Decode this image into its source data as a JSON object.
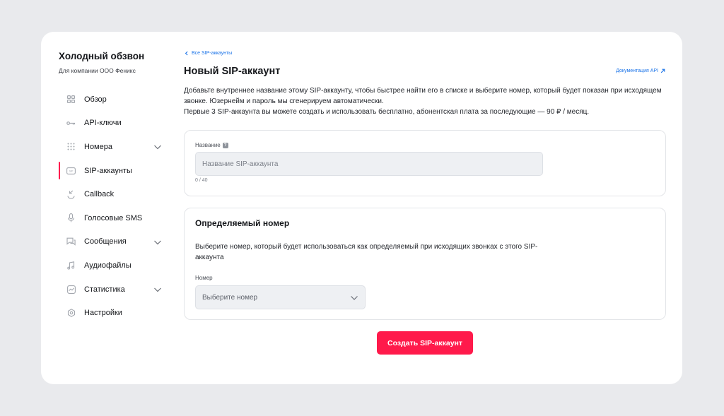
{
  "app": {
    "title": "Холодный обзвон",
    "subtitle": "Для компании ООО Феникс"
  },
  "sidebar": {
    "items": [
      {
        "label": "Обзор",
        "icon": "grid-icon",
        "expandable": false,
        "active": false
      },
      {
        "label": "API-ключи",
        "icon": "key-icon",
        "expandable": false,
        "active": false
      },
      {
        "label": "Номера",
        "icon": "dialpad-icon",
        "expandable": true,
        "active": false
      },
      {
        "label": "SIP-аккаунты",
        "icon": "sip-icon",
        "expandable": false,
        "active": true
      },
      {
        "label": "Callback",
        "icon": "callback-icon",
        "expandable": false,
        "active": false
      },
      {
        "label": "Голосовые SMS",
        "icon": "microphone-icon",
        "expandable": false,
        "active": false
      },
      {
        "label": "Сообщения",
        "icon": "chat-icon",
        "expandable": true,
        "active": false
      },
      {
        "label": "Аудиофайлы",
        "icon": "music-note-icon",
        "expandable": false,
        "active": false
      },
      {
        "label": "Статистика",
        "icon": "chart-icon",
        "expandable": true,
        "active": false
      },
      {
        "label": "Настройки",
        "icon": "settings-icon",
        "expandable": false,
        "active": false
      }
    ]
  },
  "main": {
    "back_link": "Все SIP-аккаунты",
    "page_title": "Новый SIP-аккаунт",
    "doc_link": "Документация API",
    "intro_line1": "Добавьте внутреннее название этому SIP-аккаунту, чтобы быстрее найти его в списке и выберите номер, который будет показан при исходящем звонке. Юзернейм и пароль мы сгенерируем автоматически.",
    "intro_line2": "Первые 3 SIP-аккаунта вы можете создать и использовать бесплатно, абонентская плата за последующие — 90 ₽ / месяц.",
    "name_field": {
      "label": "Название",
      "help": "?",
      "placeholder": "Название SIP-аккаунта",
      "value": "",
      "counter": "0 / 40"
    },
    "caller_section": {
      "title": "Определяемый номер",
      "description": "Выберите номер, который будет использоваться как определяемый при исходящих звонках с этого SIP-аккаунта",
      "number_label": "Номер",
      "number_placeholder": "Выберите номер"
    },
    "submit_label": "Создать SIP-аккаунт"
  },
  "colors": {
    "accent": "#ff1a4b",
    "link": "#1a73e8",
    "background": "#e9eaed",
    "input_bg": "#eef0f3"
  }
}
